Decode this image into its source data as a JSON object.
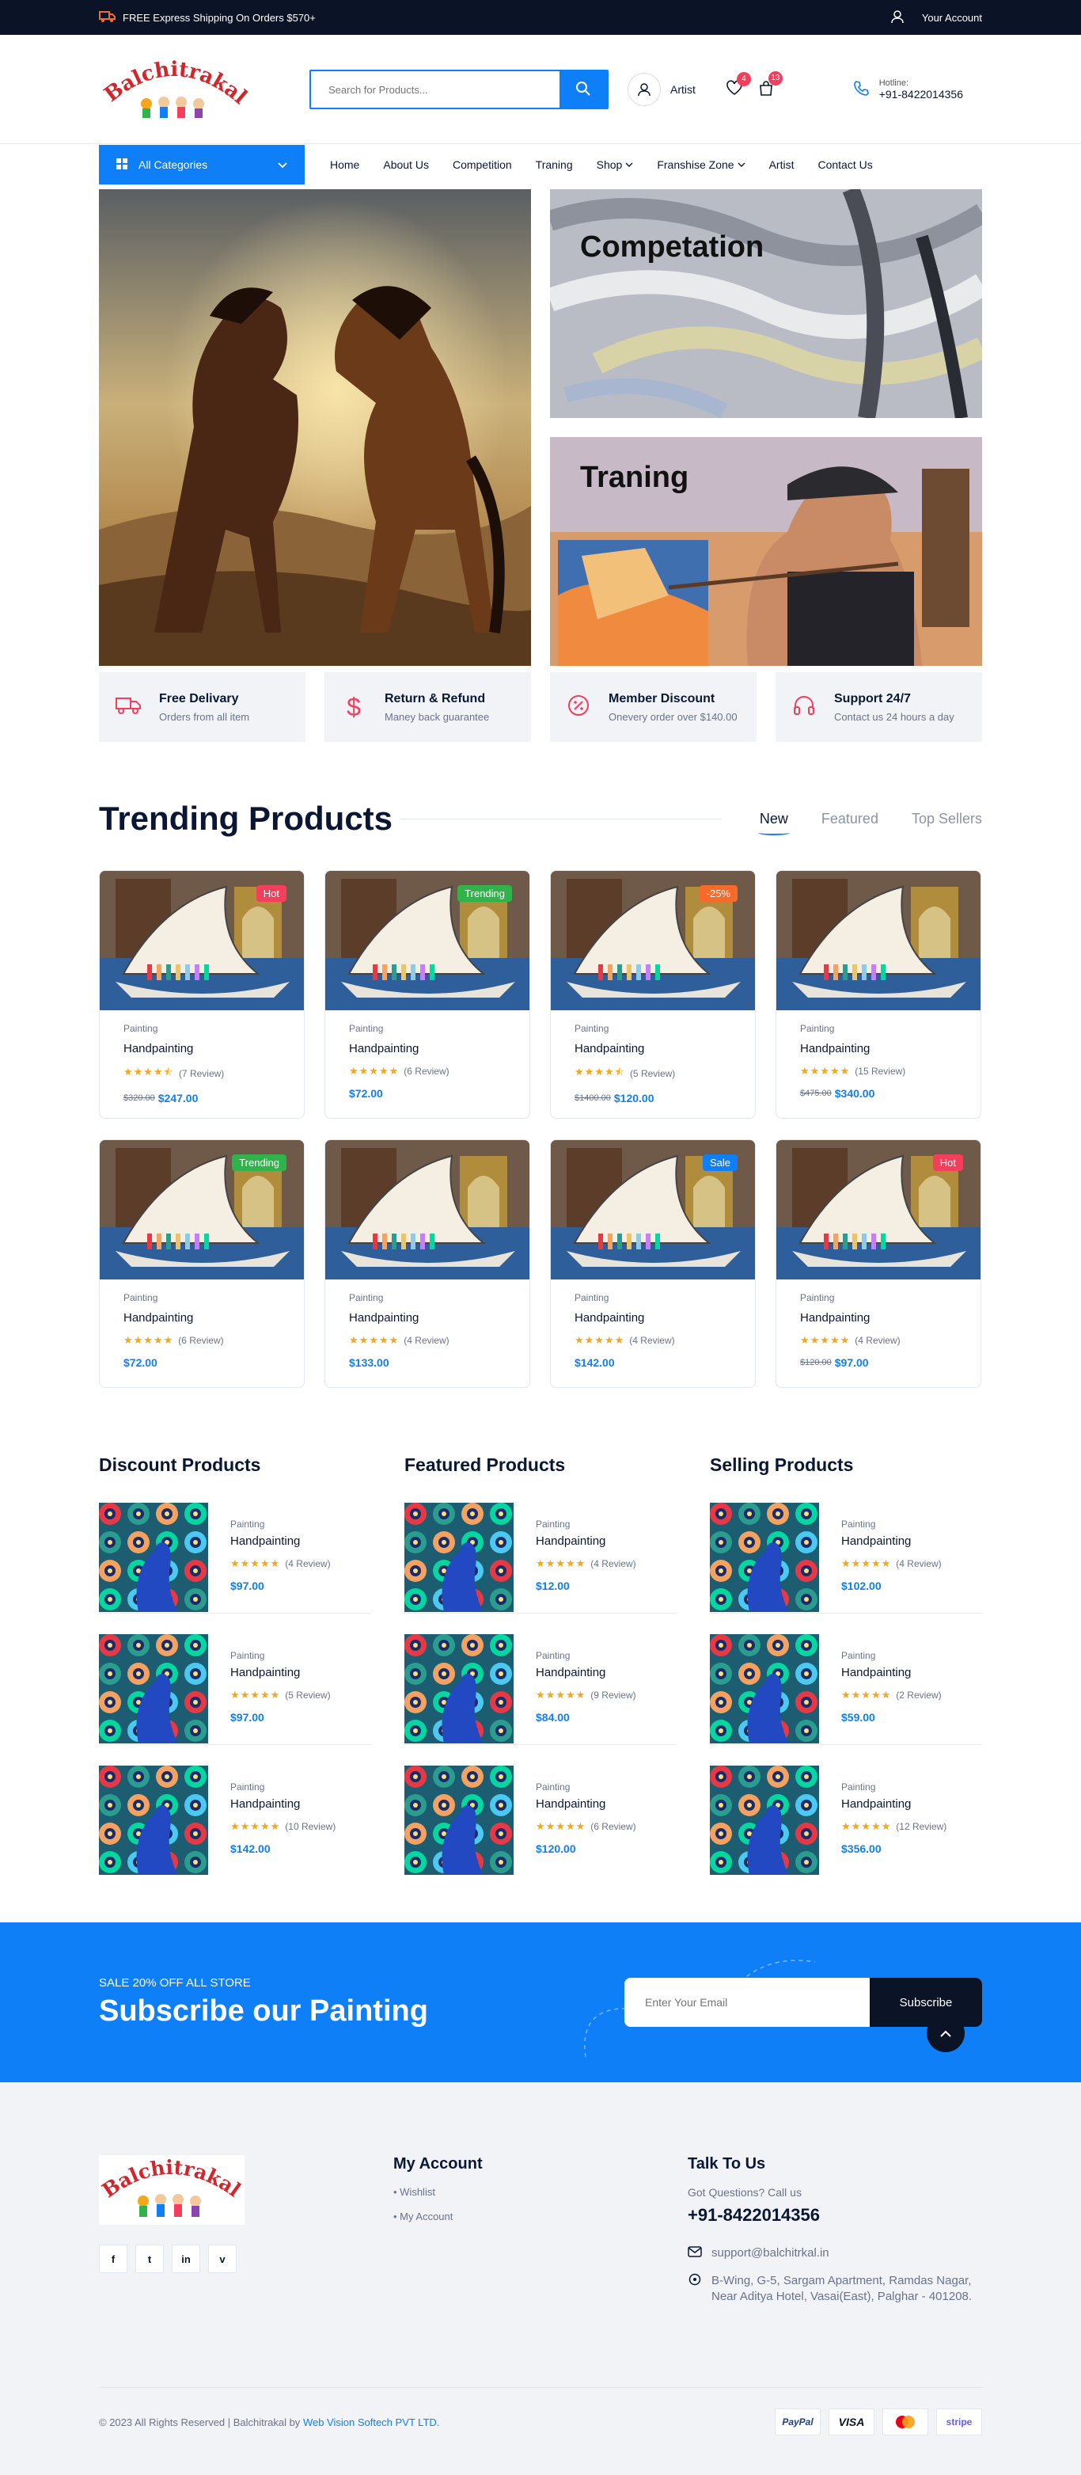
{
  "topbar": {
    "shipping_text": "FREE Express Shipping On Orders $570+",
    "account_label": "Your Account"
  },
  "header": {
    "logo_text": "Balchitrakala",
    "search_placeholder": "Search for Products...",
    "artist_label": "Artist",
    "wishlist_count": "4",
    "cart_count": "13",
    "hotline_label": "Hotline:",
    "hotline_number": "+91-8422014356"
  },
  "nav": {
    "all_categories": "All Categories",
    "items": [
      "Home",
      "About Us",
      "Competition",
      "Traning",
      "Shop",
      "Franshise Zone",
      "Artist",
      "Contact Us"
    ]
  },
  "hero": {
    "card1_title": "Competation",
    "card2_title": "Traning"
  },
  "features": [
    {
      "title": "Free Delivary",
      "sub": "Orders from all item",
      "icon": "truck-icon"
    },
    {
      "title": "Return & Refund",
      "sub": "Maney back guarantee",
      "icon": "dollar-icon"
    },
    {
      "title": "Member Discount",
      "sub": "Onevery order over $140.00",
      "icon": "discount-icon"
    },
    {
      "title": "Support 24/7",
      "sub": "Contact us 24 hours a day",
      "icon": "headset-icon"
    }
  ],
  "trending": {
    "title": "Trending Products",
    "tabs": [
      "New",
      "Featured",
      "Top Sellers"
    ],
    "products": [
      {
        "tag": "Hot",
        "tag_color": "#f43e5b",
        "cat": "Painting",
        "name": "Handpainting",
        "stars": 4.5,
        "reviews": "(7 Review)",
        "old": "$320.00",
        "price": "$247.00"
      },
      {
        "tag": "Trending",
        "tag_color": "#2fb34a",
        "cat": "Painting",
        "name": "Handpainting",
        "stars": 5,
        "reviews": "(6 Review)",
        "old": "",
        "price": "$72.00"
      },
      {
        "tag": "-25%",
        "tag_color": "#f76a2a",
        "cat": "Painting",
        "name": "Handpainting",
        "stars": 4.5,
        "reviews": "(5 Review)",
        "old": "$1400.00",
        "price": "$120.00"
      },
      {
        "tag": "",
        "tag_color": "",
        "cat": "Painting",
        "name": "Handpainting",
        "stars": 5,
        "reviews": "(15 Review)",
        "old": "$475.00",
        "price": "$340.00"
      },
      {
        "tag": "Trending",
        "tag_color": "#2fb34a",
        "cat": "Painting",
        "name": "Handpainting",
        "stars": 5,
        "reviews": "(6 Review)",
        "old": "",
        "price": "$72.00"
      },
      {
        "tag": "",
        "tag_color": "",
        "cat": "Painting",
        "name": "Handpainting",
        "stars": 5,
        "reviews": "(4 Review)",
        "old": "",
        "price": "$133.00"
      },
      {
        "tag": "Sale",
        "tag_color": "#0e7ff7",
        "cat": "Painting",
        "name": "Handpainting",
        "stars": 5,
        "reviews": "(4 Review)",
        "old": "",
        "price": "$142.00"
      },
      {
        "tag": "Hot",
        "tag_color": "#f43e5b",
        "cat": "Painting",
        "name": "Handpainting",
        "stars": 5,
        "reviews": "(4 Review)",
        "old": "$120.00",
        "price": "$97.00"
      }
    ]
  },
  "lists": [
    {
      "title": "Discount Products",
      "items": [
        {
          "cat": "Painting",
          "name": "Handpainting",
          "reviews": "(4 Review)",
          "price": "$97.00"
        },
        {
          "cat": "Painting",
          "name": "Handpainting",
          "reviews": "(5 Review)",
          "price": "$97.00"
        },
        {
          "cat": "Painting",
          "name": "Handpainting",
          "reviews": "(10 Review)",
          "price": "$142.00"
        }
      ]
    },
    {
      "title": "Featured Products",
      "items": [
        {
          "cat": "Painting",
          "name": "Handpainting",
          "reviews": "(4 Review)",
          "price": "$12.00"
        },
        {
          "cat": "Painting",
          "name": "Handpainting",
          "reviews": "(9 Review)",
          "price": "$84.00"
        },
        {
          "cat": "Painting",
          "name": "Handpainting",
          "reviews": "(6 Review)",
          "price": "$120.00"
        }
      ]
    },
    {
      "title": "Selling Products",
      "items": [
        {
          "cat": "Painting",
          "name": "Handpainting",
          "reviews": "(4 Review)",
          "price": "$102.00"
        },
        {
          "cat": "Painting",
          "name": "Handpainting",
          "reviews": "(2 Review)",
          "price": "$59.00"
        },
        {
          "cat": "Painting",
          "name": "Handpainting",
          "reviews": "(12 Review)",
          "price": "$356.00"
        }
      ]
    }
  ],
  "subscribe": {
    "small": "SALE 20% OFF ALL STORE",
    "big": "Subscribe our Painting",
    "placeholder": "Enter Your Email",
    "button": "Subscribe"
  },
  "footer": {
    "account_title": "My Account",
    "account_links": [
      "Wishlist",
      "My Account"
    ],
    "talk_title": "Talk To Us",
    "questions": "Got Questions? Call us",
    "phone": "+91-8422014356",
    "email": "support@balchitrkal.in",
    "address": "B-Wing, G-5, Sargam Apartment, Ramdas Nagar, Near Aditya Hotel, Vasai(East), Palghar - 401208.",
    "social": [
      "f",
      "t",
      "in",
      "v"
    ],
    "copyright": "© 2023 All Rights Reserved | Balchitrakal by",
    "company": "Web Vision Softech PVT LTD.",
    "payments": [
      "PayPal",
      "VISA",
      "mastercard",
      "stripe"
    ]
  },
  "colors": {
    "accent": "#0e7ff7",
    "dark": "#0b1426",
    "hot": "#f43e5b",
    "star": "#f6a61b"
  }
}
